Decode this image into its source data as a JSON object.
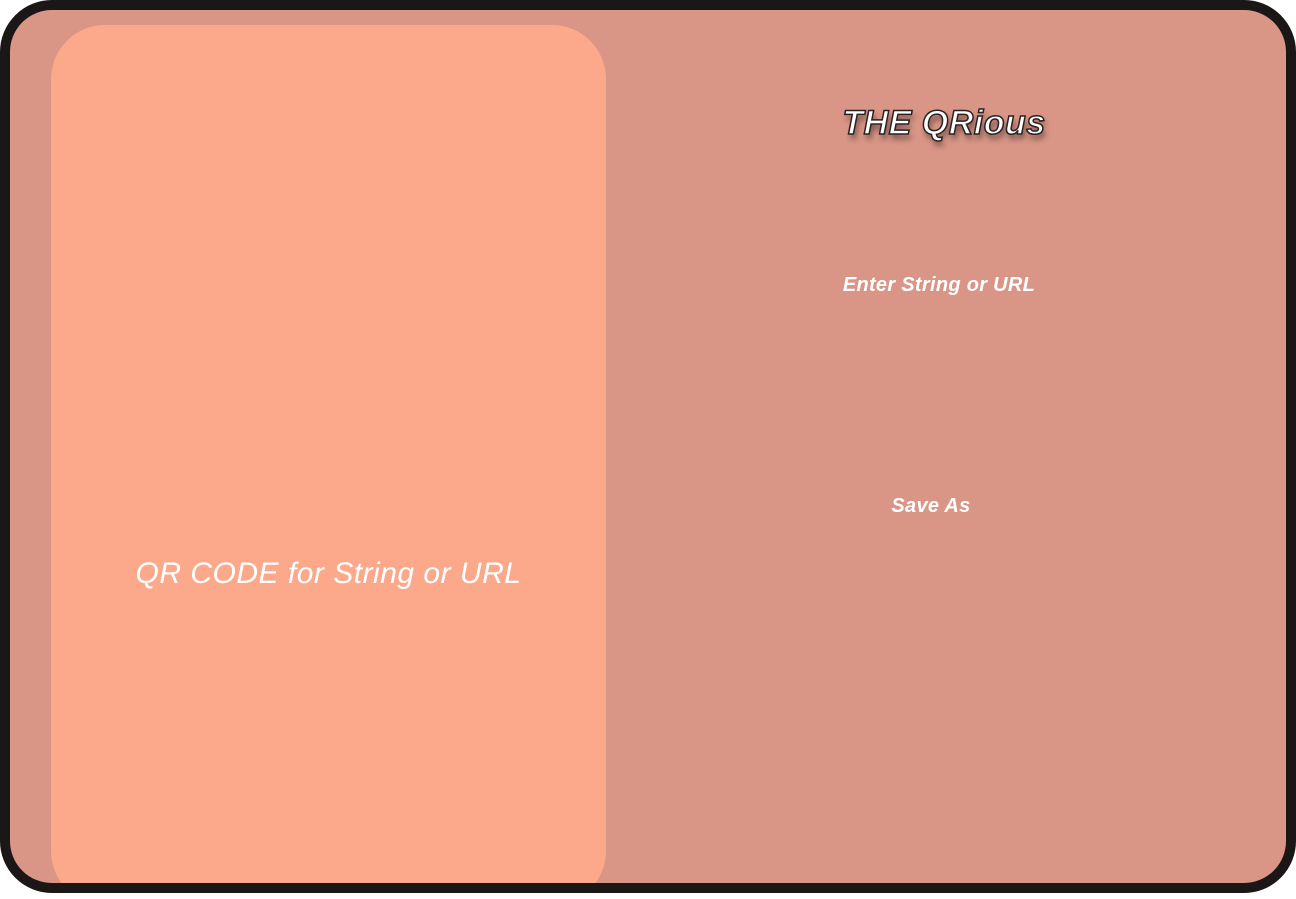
{
  "window": {
    "app_title": "THE QRious"
  },
  "qr_panel": {
    "caption": "QR CODE for String or URL"
  },
  "form": {
    "input_label": "Enter String or URL",
    "save_label": "Save As"
  },
  "colors": {
    "frame_border": "#1c1717",
    "background": "#d99586",
    "qr_panel": "#fca98b",
    "text": "#ffffff"
  }
}
